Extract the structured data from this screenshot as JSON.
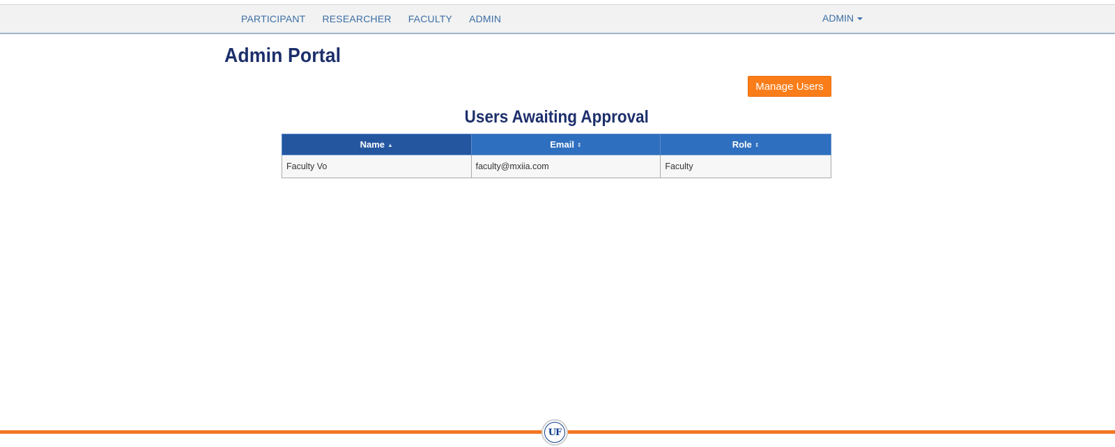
{
  "nav": {
    "links": [
      "PARTICIPANT",
      "RESEARCHER",
      "FACULTY",
      "ADMIN"
    ],
    "user_menu": "ADMIN"
  },
  "page": {
    "title": "Admin Portal",
    "manage_users_label": "Manage Users"
  },
  "approvals": {
    "title": "Users Awaiting Approval",
    "columns": [
      "Name",
      "Email",
      "Role"
    ],
    "sorted_column": "Name",
    "rows": [
      {
        "name": "Faculty Vo",
        "email": "faculty@mxiia.com",
        "role": "Faculty"
      }
    ]
  },
  "footer": {
    "logo_text": "UF",
    "accent_color": "#f37521"
  }
}
